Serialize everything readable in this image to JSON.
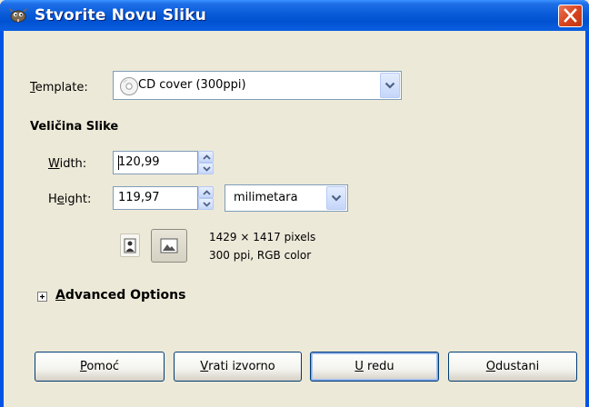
{
  "window": {
    "title": "Stvorite Novu Sliku",
    "app_icon": "gimp-icon",
    "close_icon": "close-icon"
  },
  "template": {
    "label_mnemonic": "T",
    "label_rest": "emplate:",
    "value": "CD cover (300ppi)",
    "icon": "cd-icon"
  },
  "image_size": {
    "heading": "Veličina Slike",
    "width_label_mnemonic": "W",
    "width_label_rest": "idth:",
    "width_value": "120,99",
    "height_label_pre": "H",
    "height_label_mnemonic": "e",
    "height_label_rest": "ight:",
    "height_value": "119,97",
    "unit": "milimetara",
    "pixels_info": "1429 × 1417 pixels",
    "resolution_info": "300 ppi, RGB color",
    "portrait_icon": "portrait-icon",
    "landscape_icon": "landscape-icon"
  },
  "advanced": {
    "expander_icon": "expand-plus-icon",
    "label_mnemonic": "A",
    "label_rest": "dvanced Options"
  },
  "buttons": {
    "help_mnemonic": "P",
    "help_rest": "omoć",
    "reset_mnemonic": "V",
    "reset_rest": "rati izvorno",
    "ok_mnemonic": "U",
    "ok_rest": " redu",
    "cancel_mnemonic": "O",
    "cancel_rest": "dustani"
  },
  "colors": {
    "titlebar": "#0055E5",
    "dialog_bg": "#ECE9D8",
    "close_button": "#D9441F"
  }
}
